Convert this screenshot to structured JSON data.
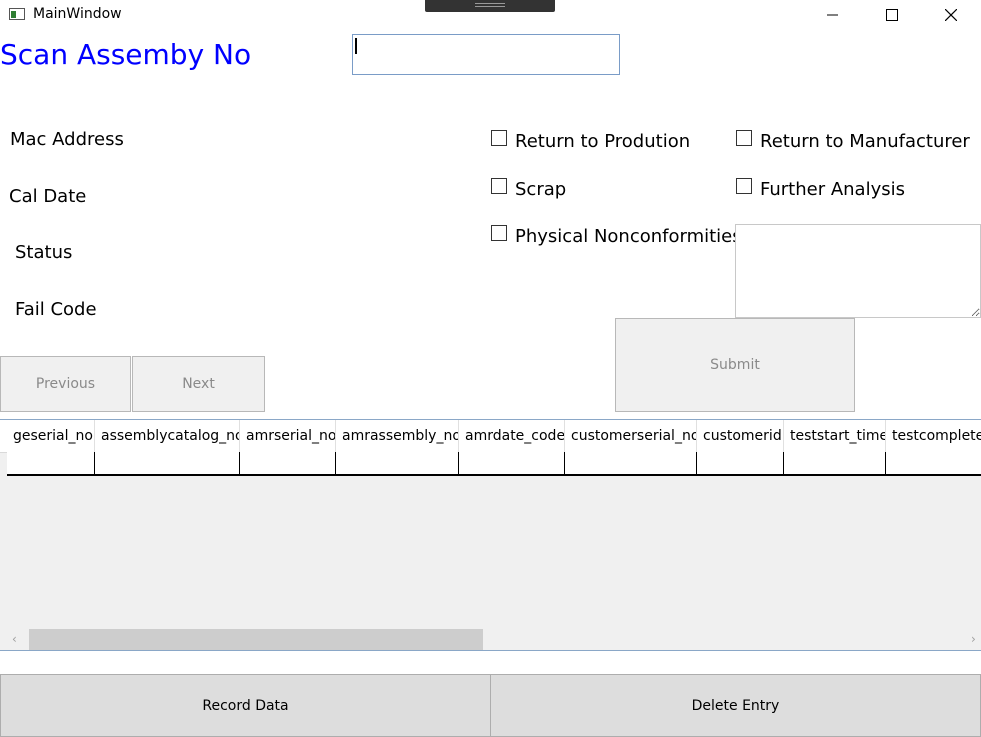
{
  "window": {
    "title": "MainWindow",
    "minimize_glyph": "—",
    "maximize_glyph": "☐",
    "close_glyph": "✕"
  },
  "header": {
    "scan_label": "Scan Assemby No",
    "scan_value": ""
  },
  "fields": {
    "mac_address": "Mac Address",
    "cal_date": "Cal Date",
    "status": "Status",
    "fail_code": "Fail Code"
  },
  "checks": {
    "return_production": "Return to Prodution",
    "return_manufacturer": "Return to Manufacturer",
    "scrap": "Scrap",
    "further_analysis": "Further Analysis",
    "physical_nonconformities": "Physical Nonconformities"
  },
  "buttons": {
    "previous": "Previous",
    "next": "Next",
    "submit": "Submit",
    "record_data": "Record Data",
    "delete_entry": "Delete Entry"
  },
  "grid": {
    "columns": [
      "geserial_no",
      "assemblycatalog_no",
      "amrserial_no",
      "amrassembly_no",
      "amrdate_code",
      "customerserial_no",
      "customerid",
      "teststart_time",
      "testcomplete_"
    ],
    "scroll_left": "‹",
    "scroll_right": "›"
  },
  "icons": {
    "app": "app-window-icon",
    "minimize": "minimize-icon",
    "maximize": "maximize-icon",
    "close": "close-icon"
  }
}
